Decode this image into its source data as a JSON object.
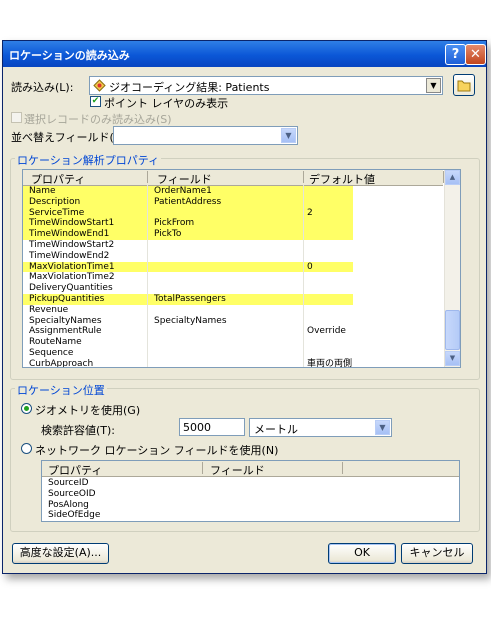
{
  "dialog": {
    "title": "ロケーションの読み込み"
  },
  "load": {
    "label": "読み込み(L):",
    "source": "ジオコーディング結果: Patients",
    "show_point_layers_only": "ポイント レイヤのみ表示",
    "selected_only": "選択レコードのみ読み込み(S)",
    "sort_field_label": "並べ替えフィールド(O):",
    "sort_field_value": ""
  },
  "props_group": {
    "title": "ロケーション解析プロパティ",
    "headers": [
      "プロパティ",
      "フィールド",
      "デフォルト値"
    ],
    "rows": [
      {
        "property": "Name",
        "field": "OrderName1",
        "default": "",
        "highlight": true
      },
      {
        "property": "Description",
        "field": "PatientAddress",
        "default": "",
        "highlight": true
      },
      {
        "property": "ServiceTime",
        "field": "",
        "default": "2",
        "highlight": true
      },
      {
        "property": "TimeWindowStart1",
        "field": "PickFrom",
        "default": "",
        "highlight": true
      },
      {
        "property": "TimeWindowEnd1",
        "field": "PickTo",
        "default": "",
        "highlight": true
      },
      {
        "property": "TimeWindowStart2",
        "field": "",
        "default": "",
        "highlight": false
      },
      {
        "property": "TimeWindowEnd2",
        "field": "",
        "default": "",
        "highlight": false
      },
      {
        "property": "MaxViolationTime1",
        "field": "",
        "default": "0",
        "highlight": true
      },
      {
        "property": "MaxViolationTime2",
        "field": "",
        "default": "",
        "highlight": false
      },
      {
        "property": "DeliveryQuantities",
        "field": "",
        "default": "",
        "highlight": false
      },
      {
        "property": "PickupQuantities",
        "field": "TotalPassengers",
        "default": "",
        "highlight": true
      },
      {
        "property": "Revenue",
        "field": "",
        "default": "",
        "highlight": false
      },
      {
        "property": "SpecialtyNames",
        "field": "SpecialtyNames",
        "default": "",
        "highlight": false
      },
      {
        "property": "AssignmentRule",
        "field": "",
        "default": "Override",
        "highlight": false
      },
      {
        "property": "RouteName",
        "field": "",
        "default": "",
        "highlight": false
      },
      {
        "property": "Sequence",
        "field": "",
        "default": "",
        "highlight": false
      },
      {
        "property": "CurbApproach",
        "field": "",
        "default": "車両の両側",
        "highlight": false
      }
    ]
  },
  "position_group": {
    "title": "ロケーション位置",
    "use_geometry": "ジオメトリを使用(G)",
    "tolerance_label": "検索許容値(T):",
    "tolerance_value": "5000",
    "tolerance_unit": "メートル",
    "use_network_fields": "ネットワーク ロケーション フィールドを使用(N)",
    "net_headers": [
      "プロパティ",
      "フィールド"
    ],
    "net_rows": [
      "SourceID",
      "SourceOID",
      "PosAlong",
      "SideOfEdge"
    ]
  },
  "buttons": {
    "advanced": "高度な設定(A)...",
    "ok": "OK",
    "cancel": "キャンセル"
  },
  "colors": {
    "highlight": "#ffff66",
    "titlebar": "#0b57d7",
    "group_title": "#0046d5"
  }
}
